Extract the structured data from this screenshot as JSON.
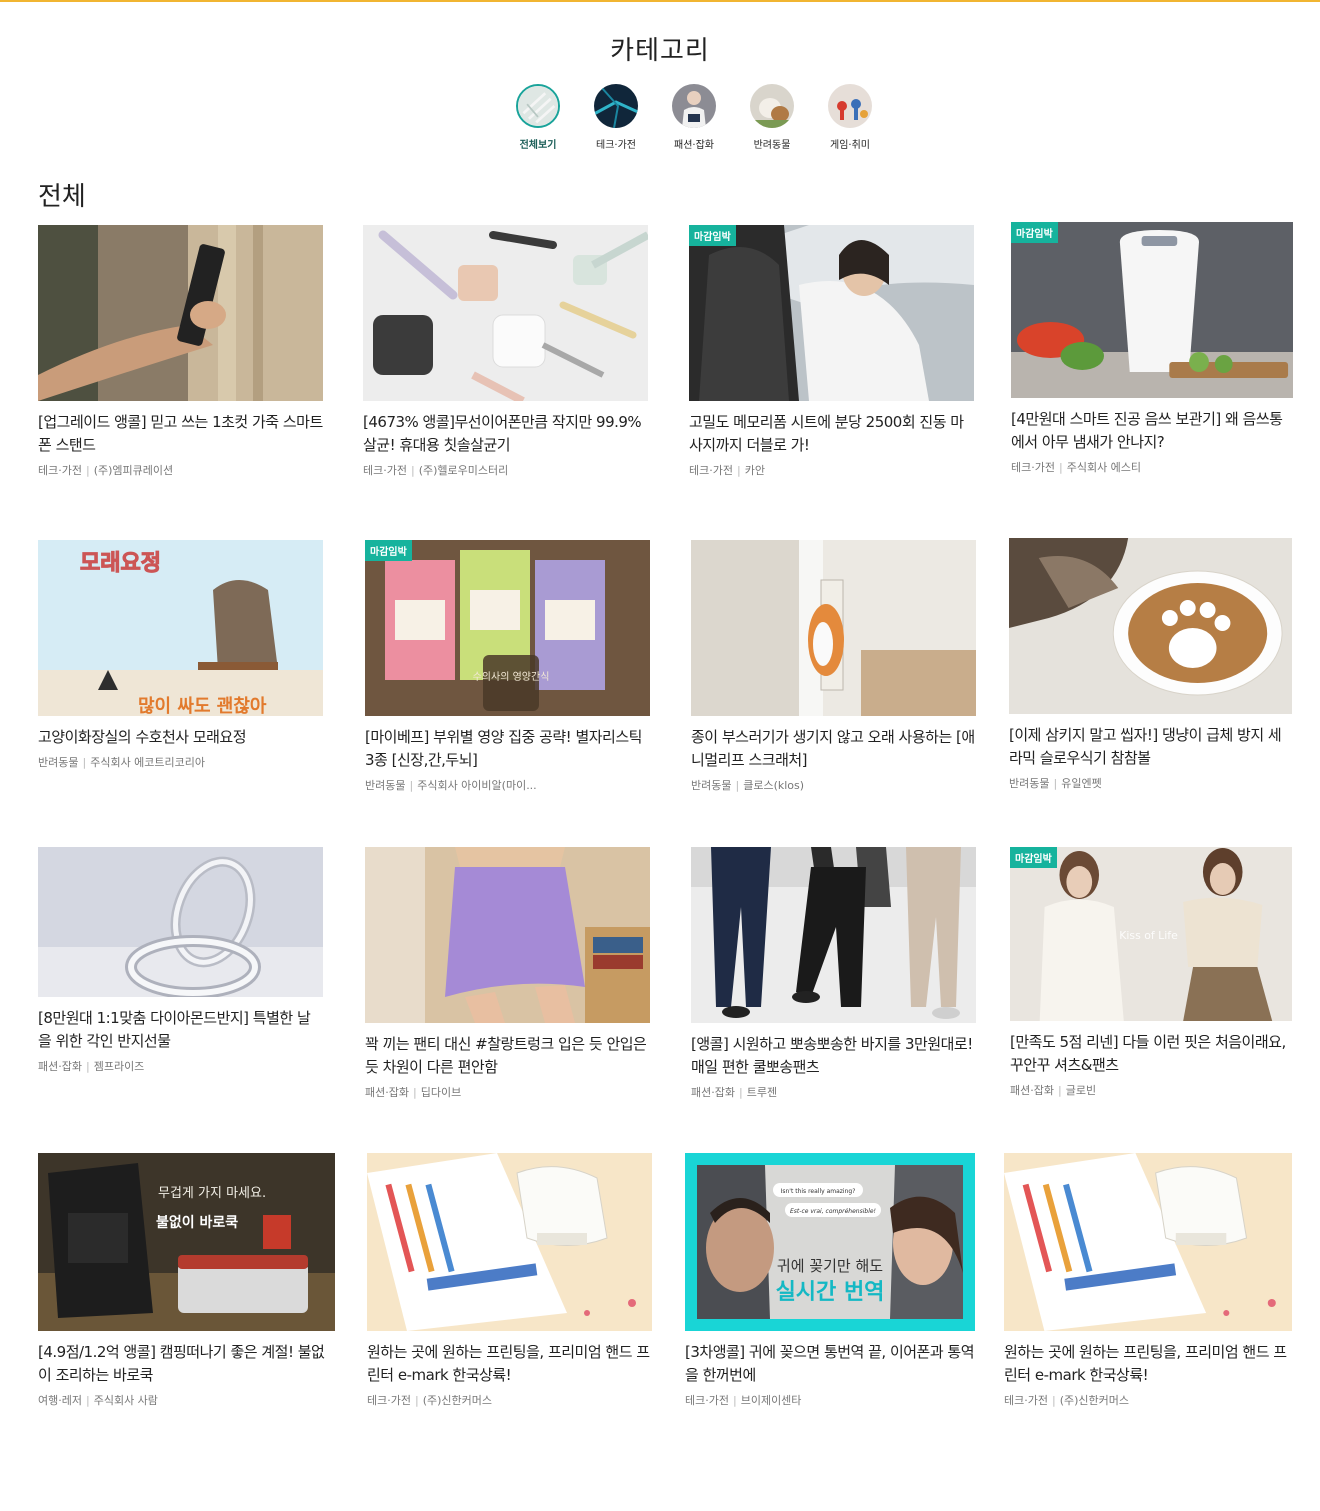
{
  "category_section": {
    "title": "카테고리",
    "items": [
      {
        "label": "전체보기",
        "active": true
      },
      {
        "label": "테크·가전",
        "active": false
      },
      {
        "label": "패션·잡화",
        "active": false
      },
      {
        "label": "반려동물",
        "active": false
      },
      {
        "label": "게임·취미",
        "active": false
      }
    ]
  },
  "section_title": "전체",
  "badge_text": "마감임박",
  "products": [
    {
      "title": "[업그레이드 앵콜] 믿고 쓰는 1초컷 가죽 스마트폰 스탠드",
      "category": "테크·가전",
      "company": "(주)엠피큐레이션",
      "badge": false
    },
    {
      "title": "[4673% 앵콜]무선이어폰만큼 작지만 99.9% 살균! 휴대용 칫솔살균기",
      "category": "테크·가전",
      "company": "(주)헬로우미스터리",
      "badge": false
    },
    {
      "title": "고밀도 메모리폼 시트에 분당 2500회 진동 마사지까지 더블로 가!",
      "category": "테크·가전",
      "company": "카안",
      "badge": true
    },
    {
      "title": "[4만원대 스마트 진공 음쓰 보관기] 왜 음쓰통에서 아무 냄새가 안나지?",
      "category": "테크·가전",
      "company": "주식회사 에스티",
      "badge": true
    },
    {
      "title": "고양이화장실의 수호천사 모래요정",
      "category": "반려동물",
      "company": "주식회사 에코트리코리아",
      "badge": false
    },
    {
      "title": "[마이베프] 부위별 영양 집중 공략! 별자리스틱 3종 [신장,간,두뇌]",
      "category": "반려동물",
      "company": "주식회사 아이비알(마이...",
      "badge": true
    },
    {
      "title": "종이 부스러기가 생기지 않고 오래 사용하는 [애니멀리프 스크래처]",
      "category": "반려동물",
      "company": "클로스(klos)",
      "badge": false
    },
    {
      "title": "[이제 삼키지 말고 씹자!] 댕냥이 급체 방지 세라믹 슬로우식기 참참볼",
      "category": "반려동물",
      "company": "유일엔펫",
      "badge": false
    },
    {
      "title": "[8만원대 1:1맞춤 다이아몬드반지] 특별한 날을 위한 각인 반지선물",
      "category": "패션·잡화",
      "company": "젬프라이즈",
      "badge": false
    },
    {
      "title": "꽉 끼는 팬티 대신 #찰랑트렁크 입은 듯 안입은 듯 차원이 다른 편안함",
      "category": "패션·잡화",
      "company": "딥다이브",
      "badge": false
    },
    {
      "title": "[앵콜] 시원하고 뽀송뽀송한 바지를 3만원대로! 매일 편한 쿨뽀송팬츠",
      "category": "패션·잡화",
      "company": "트루젠",
      "badge": false
    },
    {
      "title": "[만족도 5점 리넨] 다들 이런 핏은 처음이래요, 꾸안꾸 셔츠&팬츠",
      "category": "패션·잡화",
      "company": "글로빈",
      "badge": true
    },
    {
      "title": "[4.9점/1.2억 앵콜] 캠핑떠나기 좋은 계절! 불없이 조리하는 바로쿡",
      "category": "여행·레저",
      "company": "주식회사 사람",
      "badge": false
    },
    {
      "title": "원하는 곳에 원하는 프린팅을, 프리미엄 핸드 프린터 e-mark 한국상륙!",
      "category": "테크·가전",
      "company": "(주)신한커머스",
      "badge": false
    },
    {
      "title": "[3차앵콜] 귀에 꽂으면 통번역 끝, 이어폰과 통역을 한꺼번에",
      "category": "테크·가전",
      "company": "브이제이센타",
      "badge": false
    },
    {
      "title": "원하는 곳에 원하는 프린팅을, 프리미엄 핸드 프린터 e-mark 한국상륙!",
      "category": "테크·가전",
      "company": "(주)신한커머스",
      "badge": false
    }
  ],
  "image_texts": {
    "sand_fairy_logo": "모래요정",
    "sand_fairy_caption": "많이 싸도 괜찮아",
    "vet_stamp": "수의사의 영양간식",
    "linen_overlay": "Kiss of Life",
    "barocook_line1": "무겁게 가지 마세요.",
    "barocook_line2": "불없이 바로쿡",
    "translator_bubble1": "Isn't this really amazing?",
    "translator_bubble2": "Est-ce vrai, compréhensible!",
    "translator_line1": "귀에 꽂기만 해도",
    "translator_line2": "실시간 번역"
  }
}
